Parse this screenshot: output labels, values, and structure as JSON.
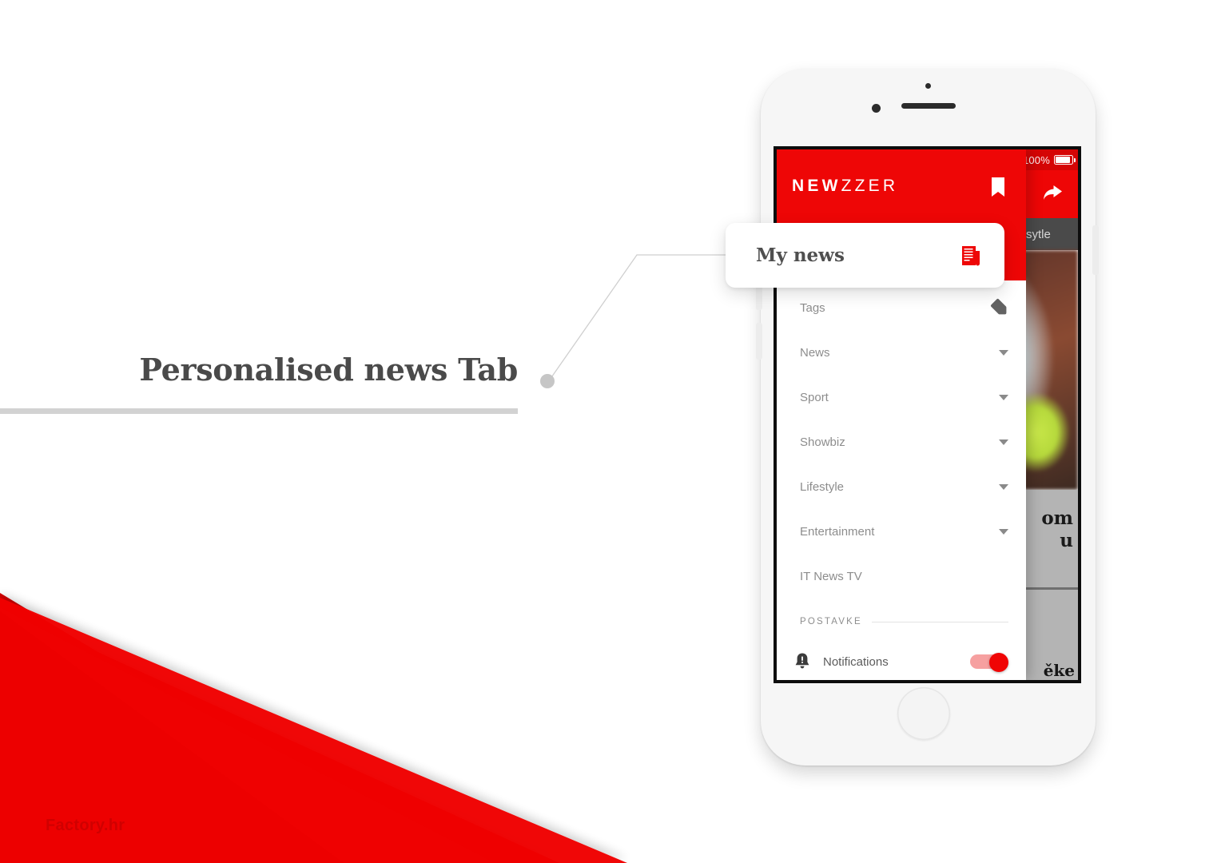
{
  "slide": {
    "caption_title": "Personalised news Tab",
    "watermark": "Factory.hr",
    "accent_red": "#ee0606",
    "caption_rule_color": "#d2d2d2",
    "background": "#ffffff"
  },
  "callout": {
    "title": "My news",
    "icon": "newspaper-icon",
    "icon_color": "#ee0606"
  },
  "phone": {
    "device": "white smartphone mockup",
    "status_bar": {
      "battery_percent": "100%",
      "battery_icon": "battery-full-icon"
    }
  },
  "drawer": {
    "brand": {
      "bold_part": "NEW",
      "light_part": "ZZER"
    },
    "bookmark_icon": "bookmark-icon",
    "items": [
      {
        "label": "Tags",
        "trailing": "tag-icon",
        "expandable": false
      },
      {
        "label": "News",
        "trailing": "chevron-down-icon",
        "expandable": true
      },
      {
        "label": "Sport",
        "trailing": "chevron-down-icon",
        "expandable": true
      },
      {
        "label": "Showbiz",
        "trailing": "chevron-down-icon",
        "expandable": true
      },
      {
        "label": "Lifestyle",
        "trailing": "chevron-down-icon",
        "expandable": true
      },
      {
        "label": "Entertainment",
        "trailing": "chevron-down-icon",
        "expandable": true
      },
      {
        "label": "IT News TV",
        "trailing": "",
        "expandable": false
      }
    ],
    "settings": {
      "section_label": "POSTAVKE",
      "notifications_label": "Notifications",
      "notifications_icon": "bell-alert-icon",
      "notifications_on": true,
      "toggle_on_color": "#f00505"
    }
  },
  "app_background": {
    "share_icon": "share-arrow-icon",
    "nav_tabs": [
      "ifesytle"
    ],
    "article_headline_fragment": "om\nu",
    "article_snippet_fragment": "ěke"
  }
}
